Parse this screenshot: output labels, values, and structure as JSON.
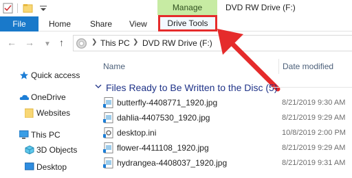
{
  "titlebar": {
    "contextual_tab": "Manage",
    "window_title": "DVD RW Drive (F:)"
  },
  "ribbon": {
    "file_label": "File",
    "tabs": [
      "Home",
      "Share",
      "View"
    ],
    "drive_tools_label": "Drive Tools",
    "highlight_color": "#e52b2b"
  },
  "address": {
    "crumbs": [
      "This PC",
      "DVD RW Drive (F:)"
    ]
  },
  "navpane": {
    "items": [
      "Quick access",
      "OneDrive",
      "Websites",
      "This PC",
      "3D Objects",
      "Desktop"
    ]
  },
  "columns": {
    "name": "Name",
    "date_modified": "Date modified"
  },
  "group": {
    "title": "Files Ready to Be Written to the Disc (5)"
  },
  "files": [
    {
      "name": "butterfly-4408771_1920.jpg",
      "date": "8/21/2019 9:30 AM",
      "kind": "image"
    },
    {
      "name": "dahlia-4407530_1920.jpg",
      "date": "8/21/2019 9:29 AM",
      "kind": "image"
    },
    {
      "name": "desktop.ini",
      "date": "10/8/2019 2:00 PM",
      "kind": "settings"
    },
    {
      "name": "flower-4411108_1920.jpg",
      "date": "8/21/2019 9:29 AM",
      "kind": "image"
    },
    {
      "name": "hydrangea-4408037_1920.jpg",
      "date": "8/21/2019 9:31 AM",
      "kind": "image"
    }
  ]
}
